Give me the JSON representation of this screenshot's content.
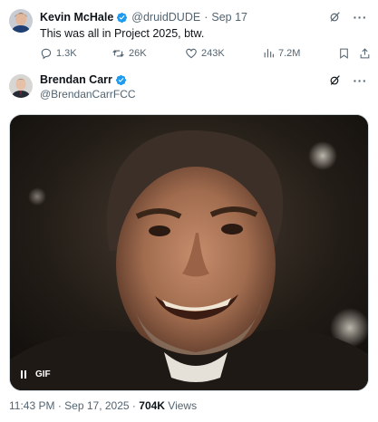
{
  "quoted_tweet": {
    "author_name": "Kevin McHale",
    "handle": "@druidDUDE",
    "separator": "·",
    "date": "Sep 17",
    "text": "This was all in Project 2025, btw.",
    "actions": {
      "replies": "1.3K",
      "retweets": "26K",
      "likes": "243K",
      "views": "7.2M"
    }
  },
  "main_tweet": {
    "author_name": "Brendan Carr",
    "handle": "@BrendanCarrFCC",
    "media": {
      "badge": "GIF",
      "state": "playing"
    },
    "meta": {
      "time": "11:43 PM",
      "sep1": "·",
      "date": "Sep 17, 2025",
      "sep2": "·",
      "views_count": "704K",
      "views_label": "Views"
    }
  },
  "colors": {
    "verified": "#1d9bf0",
    "muted": "#536471",
    "text": "#0f1419"
  },
  "icons": [
    "verified-badge-icon",
    "grok-icon",
    "more-icon",
    "reply-icon",
    "retweet-icon",
    "like-icon",
    "views-icon",
    "bookmark-icon",
    "share-icon",
    "pause-icon"
  ]
}
